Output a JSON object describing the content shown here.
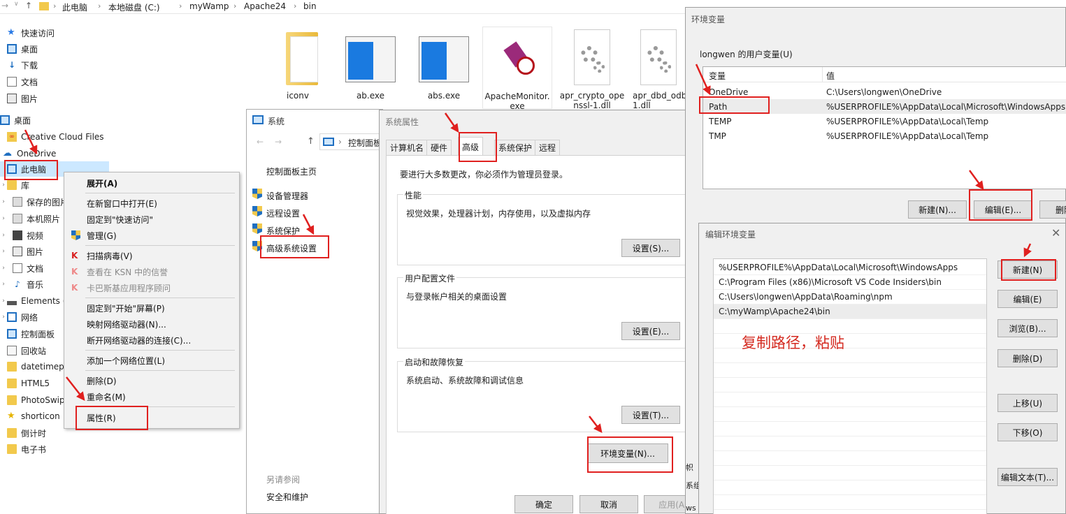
{
  "explorer": {
    "breadcrumb": [
      "此电脑",
      "本地磁盘 (C:)",
      "myWamp",
      "Apache24",
      "bin"
    ],
    "nav_items": [
      {
        "label": "快速访问",
        "icon": "star-icon"
      },
      {
        "label": "桌面",
        "icon": "desktop-icon"
      },
      {
        "label": "下载",
        "icon": "download-icon"
      },
      {
        "label": "文档",
        "icon": "document-icon"
      },
      {
        "label": "图片",
        "icon": "picture-icon"
      },
      {
        "label": "桌面",
        "icon": "desktop-icon"
      },
      {
        "label": "Creative Cloud Files",
        "icon": "creative-cloud-icon"
      },
      {
        "label": "OneDrive",
        "icon": "onedrive-icon"
      },
      {
        "label": "此电脑",
        "icon": "computer-icon"
      },
      {
        "label": "库",
        "icon": "library-icon"
      },
      {
        "label": "保存的图片",
        "icon": "folder-icon"
      },
      {
        "label": "本机照片",
        "icon": "folder-icon"
      },
      {
        "label": "视频",
        "icon": "video-icon"
      },
      {
        "label": "图片",
        "icon": "picture-icon"
      },
      {
        "label": "文档",
        "icon": "document-icon"
      },
      {
        "label": "音乐",
        "icon": "music-icon"
      },
      {
        "label": "Elements (",
        "icon": "drive-icon"
      },
      {
        "label": "网络",
        "icon": "network-icon"
      },
      {
        "label": "控制面板",
        "icon": "control-panel-icon"
      },
      {
        "label": "回收站",
        "icon": "recycle-bin-icon"
      },
      {
        "label": "datetimep",
        "icon": "folder-icon"
      },
      {
        "label": "HTML5",
        "icon": "folder-icon"
      },
      {
        "label": "PhotoSwip",
        "icon": "folder-icon"
      },
      {
        "label": "shorticon",
        "icon": "star-icon"
      },
      {
        "label": "倒计时",
        "icon": "folder-icon"
      },
      {
        "label": "电子书",
        "icon": "folder-icon"
      }
    ],
    "files": [
      {
        "name": "iconv",
        "name2": "",
        "icon": "folder-icon"
      },
      {
        "name": "ab.exe",
        "name2": "",
        "icon": "exe-window-icon"
      },
      {
        "name": "abs.exe",
        "name2": "",
        "icon": "exe-window-icon"
      },
      {
        "name": "ApacheMonitor.",
        "name2": "exe",
        "icon": "apache-monitor-icon"
      },
      {
        "name": "apr_crypto_ope",
        "name2": "nssl-1.dll",
        "icon": "dll-gear-icon"
      },
      {
        "name": "apr_dbd_odb",
        "name2": "1.dll",
        "icon": "dll-gear-icon"
      }
    ]
  },
  "context_menu": {
    "items": [
      "展开(A)",
      "在新窗口中打开(E)",
      "固定到\"快速访问\"",
      "管理(G)",
      "扫描病毒(V)",
      "查看在 KSN 中的信誉",
      "卡巴斯基应用程序顾问",
      "固定到\"开始\"屏幕(P)",
      "映射网络驱动器(N)...",
      "断开网络驱动器的连接(C)...",
      "添加一个网络位置(L)",
      "删除(D)",
      "重命名(M)",
      "属性(R)"
    ]
  },
  "control_panel": {
    "title": "系统",
    "address": "控制面板",
    "home": "控制面板主页",
    "links": [
      "设备管理器",
      "远程设置",
      "系统保护",
      "高级系统设置"
    ],
    "see_also": "另请参阅",
    "security": "安全和维护"
  },
  "system_properties": {
    "title": "系统属性",
    "tabs": [
      "计算机名",
      "硬件",
      "高级",
      "系统保护",
      "远程"
    ],
    "admin_note": "要进行大多数更改，你必须作为管理员登录。",
    "performance": {
      "title": "性能",
      "desc": "视觉效果，处理器计划，内存使用，以及虚拟内存",
      "button": "设置(S)..."
    },
    "user_profile": {
      "title": "用户配置文件",
      "desc": "与登录帐户相关的桌面设置",
      "button": "设置(E)..."
    },
    "startup": {
      "title": "启动和故障恢复",
      "desc": "系统启动、系统故障和调试信息",
      "button": "设置(T)..."
    },
    "env_button": "环境变量(N)...",
    "ok": "确定",
    "cancel": "取消",
    "apply": "应用(A)"
  },
  "env_vars": {
    "title": "环境变量",
    "user_section": "longwen 的用户变量(U)",
    "col_var": "变量",
    "col_val": "值",
    "rows": [
      {
        "name": "OneDrive",
        "value": "C:\\Users\\longwen\\OneDrive"
      },
      {
        "name": "Path",
        "value": "%USERPROFILE%\\AppData\\Local\\Microsoft\\WindowsApps;"
      },
      {
        "name": "TEMP",
        "value": "%USERPROFILE%\\AppData\\Local\\Temp"
      },
      {
        "name": "TMP",
        "value": "%USERPROFILE%\\AppData\\Local\\Temp"
      }
    ],
    "new": "新建(N)...",
    "edit": "编辑(E)...",
    "delete": "删除",
    "frag1": "帜",
    "frag2": "系组",
    "frag3": "ws :"
  },
  "edit_env": {
    "title": "编辑环境变量",
    "paths": [
      "%USERPROFILE%\\AppData\\Local\\Microsoft\\WindowsApps",
      "C:\\Program Files (x86)\\Microsoft VS Code Insiders\\bin",
      "C:\\Users\\longwen\\AppData\\Roaming\\npm",
      "C:\\myWamp\\Apache24\\bin"
    ],
    "annotation": "复制路径，粘贴",
    "buttons": [
      "新建(N)",
      "编辑(E)",
      "浏览(B)...",
      "删除(D)",
      "上移(U)",
      "下移(O)",
      "编辑文本(T)..."
    ]
  },
  "colors": {
    "highlight": "#e0201f",
    "annotation": "#d42a20"
  }
}
